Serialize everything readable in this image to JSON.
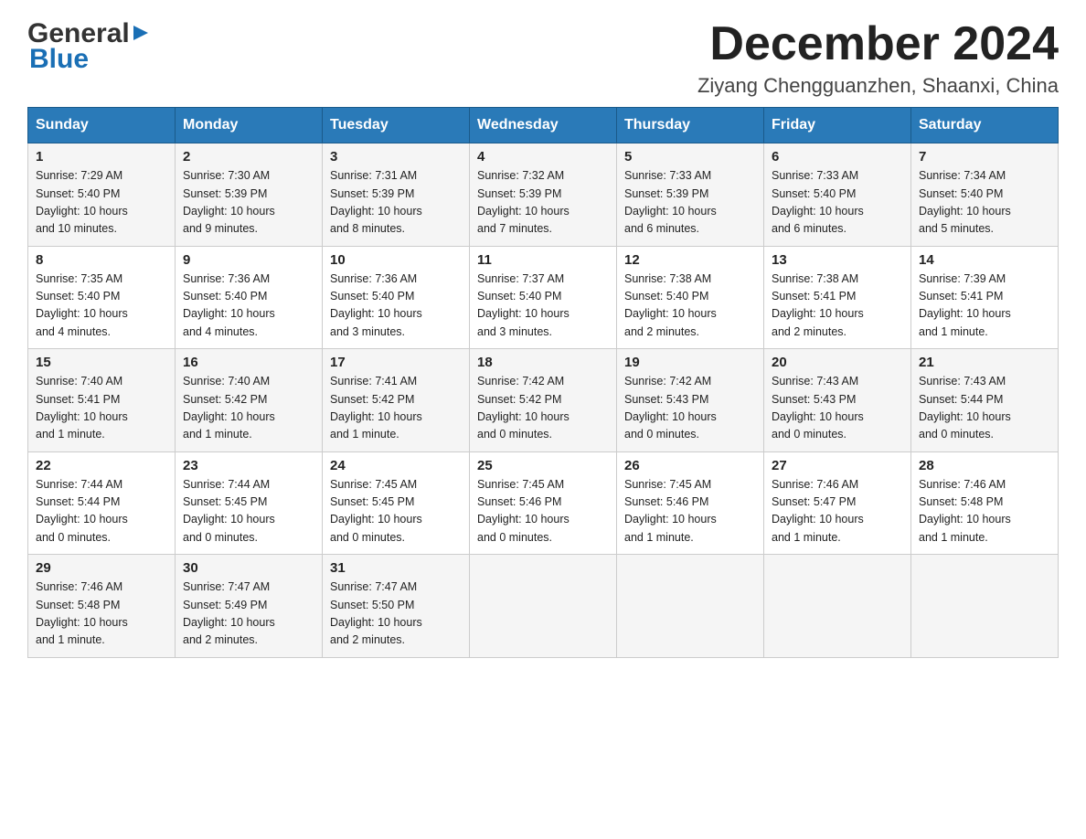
{
  "header": {
    "logo": {
      "text1": "General",
      "text2": "Blue"
    },
    "title": "December 2024",
    "location": "Ziyang Chengguanzhen, Shaanxi, China"
  },
  "calendar": {
    "days_of_week": [
      "Sunday",
      "Monday",
      "Tuesday",
      "Wednesday",
      "Thursday",
      "Friday",
      "Saturday"
    ],
    "weeks": [
      [
        {
          "day": "1",
          "sunrise": "7:29 AM",
          "sunset": "5:40 PM",
          "daylight": "10 hours and 10 minutes."
        },
        {
          "day": "2",
          "sunrise": "7:30 AM",
          "sunset": "5:39 PM",
          "daylight": "10 hours and 9 minutes."
        },
        {
          "day": "3",
          "sunrise": "7:31 AM",
          "sunset": "5:39 PM",
          "daylight": "10 hours and 8 minutes."
        },
        {
          "day": "4",
          "sunrise": "7:32 AM",
          "sunset": "5:39 PM",
          "daylight": "10 hours and 7 minutes."
        },
        {
          "day": "5",
          "sunrise": "7:33 AM",
          "sunset": "5:39 PM",
          "daylight": "10 hours and 6 minutes."
        },
        {
          "day": "6",
          "sunrise": "7:33 AM",
          "sunset": "5:40 PM",
          "daylight": "10 hours and 6 minutes."
        },
        {
          "day": "7",
          "sunrise": "7:34 AM",
          "sunset": "5:40 PM",
          "daylight": "10 hours and 5 minutes."
        }
      ],
      [
        {
          "day": "8",
          "sunrise": "7:35 AM",
          "sunset": "5:40 PM",
          "daylight": "10 hours and 4 minutes."
        },
        {
          "day": "9",
          "sunrise": "7:36 AM",
          "sunset": "5:40 PM",
          "daylight": "10 hours and 4 minutes."
        },
        {
          "day": "10",
          "sunrise": "7:36 AM",
          "sunset": "5:40 PM",
          "daylight": "10 hours and 3 minutes."
        },
        {
          "day": "11",
          "sunrise": "7:37 AM",
          "sunset": "5:40 PM",
          "daylight": "10 hours and 3 minutes."
        },
        {
          "day": "12",
          "sunrise": "7:38 AM",
          "sunset": "5:40 PM",
          "daylight": "10 hours and 2 minutes."
        },
        {
          "day": "13",
          "sunrise": "7:38 AM",
          "sunset": "5:41 PM",
          "daylight": "10 hours and 2 minutes."
        },
        {
          "day": "14",
          "sunrise": "7:39 AM",
          "sunset": "5:41 PM",
          "daylight": "10 hours and 1 minute."
        }
      ],
      [
        {
          "day": "15",
          "sunrise": "7:40 AM",
          "sunset": "5:41 PM",
          "daylight": "10 hours and 1 minute."
        },
        {
          "day": "16",
          "sunrise": "7:40 AM",
          "sunset": "5:42 PM",
          "daylight": "10 hours and 1 minute."
        },
        {
          "day": "17",
          "sunrise": "7:41 AM",
          "sunset": "5:42 PM",
          "daylight": "10 hours and 1 minute."
        },
        {
          "day": "18",
          "sunrise": "7:42 AM",
          "sunset": "5:42 PM",
          "daylight": "10 hours and 0 minutes."
        },
        {
          "day": "19",
          "sunrise": "7:42 AM",
          "sunset": "5:43 PM",
          "daylight": "10 hours and 0 minutes."
        },
        {
          "day": "20",
          "sunrise": "7:43 AM",
          "sunset": "5:43 PM",
          "daylight": "10 hours and 0 minutes."
        },
        {
          "day": "21",
          "sunrise": "7:43 AM",
          "sunset": "5:44 PM",
          "daylight": "10 hours and 0 minutes."
        }
      ],
      [
        {
          "day": "22",
          "sunrise": "7:44 AM",
          "sunset": "5:44 PM",
          "daylight": "10 hours and 0 minutes."
        },
        {
          "day": "23",
          "sunrise": "7:44 AM",
          "sunset": "5:45 PM",
          "daylight": "10 hours and 0 minutes."
        },
        {
          "day": "24",
          "sunrise": "7:45 AM",
          "sunset": "5:45 PM",
          "daylight": "10 hours and 0 minutes."
        },
        {
          "day": "25",
          "sunrise": "7:45 AM",
          "sunset": "5:46 PM",
          "daylight": "10 hours and 0 minutes."
        },
        {
          "day": "26",
          "sunrise": "7:45 AM",
          "sunset": "5:46 PM",
          "daylight": "10 hours and 1 minute."
        },
        {
          "day": "27",
          "sunrise": "7:46 AM",
          "sunset": "5:47 PM",
          "daylight": "10 hours and 1 minute."
        },
        {
          "day": "28",
          "sunrise": "7:46 AM",
          "sunset": "5:48 PM",
          "daylight": "10 hours and 1 minute."
        }
      ],
      [
        {
          "day": "29",
          "sunrise": "7:46 AM",
          "sunset": "5:48 PM",
          "daylight": "10 hours and 1 minute."
        },
        {
          "day": "30",
          "sunrise": "7:47 AM",
          "sunset": "5:49 PM",
          "daylight": "10 hours and 2 minutes."
        },
        {
          "day": "31",
          "sunrise": "7:47 AM",
          "sunset": "5:50 PM",
          "daylight": "10 hours and 2 minutes."
        },
        null,
        null,
        null,
        null
      ]
    ],
    "labels": {
      "sunrise": "Sunrise:",
      "sunset": "Sunset:",
      "daylight": "Daylight:"
    }
  }
}
